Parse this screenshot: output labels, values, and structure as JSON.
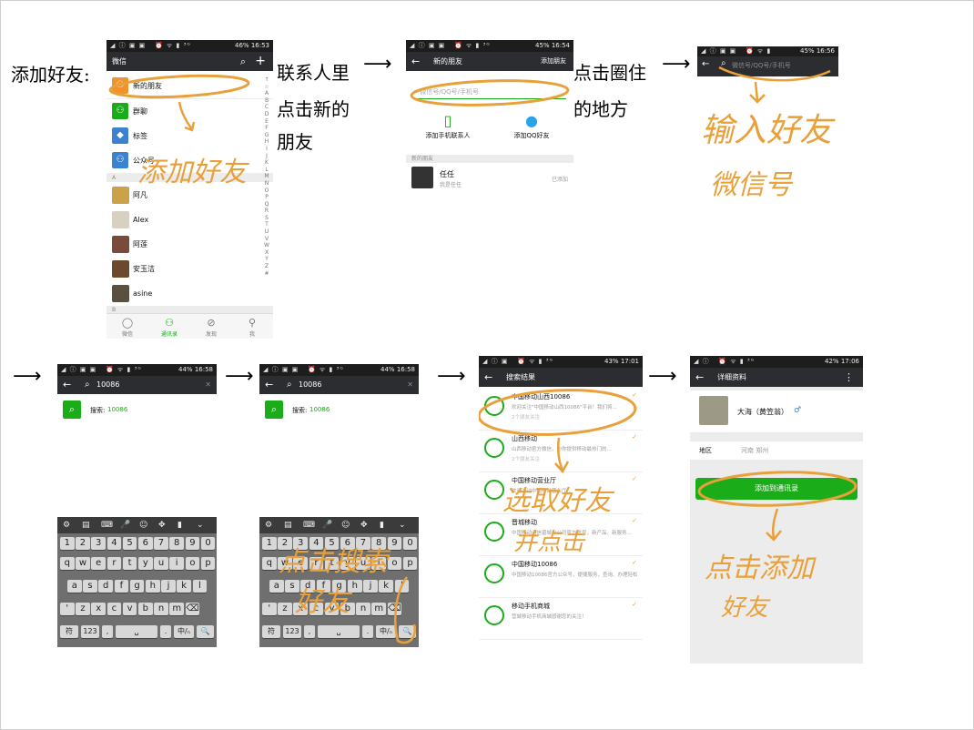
{
  "captions": {
    "intro": "添加好友:",
    "step1": [
      "联系人里",
      "点击新的",
      "朋友"
    ],
    "step2": [
      "点击圈住",
      "的地方"
    ]
  },
  "colors": {
    "accent_green": "#1aad19",
    "handwriting": "#e8a03a",
    "action_bar": "#2b2d31"
  },
  "screen1": {
    "status": {
      "battery": "46%",
      "time": "16:53"
    },
    "title": "微信",
    "search_icon": "search-icon",
    "add_icon": "plus-icon",
    "rows": [
      {
        "label": "新的朋友",
        "icon": "person-plus-icon",
        "color": "#f0932b"
      },
      {
        "label": "群聊",
        "icon": "group-icon",
        "color": "#1aad19"
      },
      {
        "label": "标签",
        "icon": "tag-icon",
        "color": "#3b82d0"
      },
      {
        "label": "公众号",
        "icon": "official-account-icon",
        "color": "#3b82d0"
      }
    ],
    "section_a": "A",
    "contacts": [
      "阿凡",
      "Alex",
      "阿莲",
      "安玉洁",
      "asine"
    ],
    "section_b": "B",
    "alphabet": [
      "↑",
      "☆",
      "A",
      "B",
      "C",
      "D",
      "E",
      "F",
      "G",
      "H",
      "I",
      "J",
      "K",
      "L",
      "M",
      "N",
      "O",
      "P",
      "Q",
      "R",
      "S",
      "T",
      "U",
      "V",
      "W",
      "X",
      "Y",
      "Z",
      "#"
    ],
    "tabs": [
      {
        "label": "微信",
        "icon": "chat-bubble-icon"
      },
      {
        "label": "通讯录",
        "icon": "contacts-icon"
      },
      {
        "label": "发现",
        "icon": "compass-icon"
      },
      {
        "label": "我",
        "icon": "profile-icon"
      }
    ],
    "handwriting": "添加好友"
  },
  "screen2": {
    "status": {
      "battery": "45%",
      "time": "16:54"
    },
    "title": "新的朋友",
    "action": "添加朋友",
    "search_placeholder": "微信号/QQ号/手机号",
    "options": [
      {
        "label": "添加手机联系人",
        "icon": "phone-icon"
      },
      {
        "label": "添加QQ好友",
        "icon": "qq-penguin-icon"
      }
    ],
    "section": "新的朋友",
    "friend": {
      "name": "任任",
      "sub": "我是任任",
      "status": "已添加"
    }
  },
  "screen3": {
    "status": {
      "battery": "45%",
      "time": "16:56"
    },
    "search_placeholder": "微信号/QQ号/手机号",
    "handwriting": [
      "输入好友",
      "微信号"
    ]
  },
  "screen4": {
    "status": {
      "battery": "44%",
      "time": "16:58"
    },
    "query": "10086",
    "result_prefix": "搜索: ",
    "result_query": "10086"
  },
  "screen5": {
    "status": {
      "battery": "44%",
      "time": "16:58"
    },
    "query": "10086",
    "result_prefix": "搜索: ",
    "result_query": "10086",
    "handwriting": [
      "点击搜索",
      "好友"
    ]
  },
  "keyboard": {
    "toolbar": [
      "⚙",
      "▤",
      "⌨",
      "🎤",
      "☺",
      "✥",
      "▮",
      "⌄"
    ],
    "row1": [
      "1",
      "2",
      "3",
      "4",
      "5",
      "6",
      "7",
      "8",
      "9",
      "0"
    ],
    "row2": [
      "q",
      "w",
      "e",
      "r",
      "t",
      "y",
      "u",
      "i",
      "o",
      "p"
    ],
    "row3": [
      "a",
      "s",
      "d",
      "f",
      "g",
      "h",
      "j",
      "k",
      "l"
    ],
    "row4": [
      "'",
      "z",
      "x",
      "c",
      "v",
      "b",
      "n",
      "m",
      "⌫"
    ],
    "row5": [
      "符",
      "123",
      ",",
      "␣",
      ".",
      "中/ₙ",
      "🔍"
    ]
  },
  "screen6": {
    "status": {
      "battery": "43%",
      "time": "17:01"
    },
    "title": "搜索结果",
    "results": [
      {
        "name": "中国移动山西10086",
        "desc": "欢迎关注\"中国移动山西10086\"平台！我们将...",
        "meta": "2个朋友关注"
      },
      {
        "name": "山西移动",
        "desc": "山西移动官方微信，为你提供移动最热门的...",
        "meta": "2个朋友关注"
      },
      {
        "name": "中国移动营业厅",
        "desc": "欢迎关注中国移动营业厅...",
        "meta": ""
      },
      {
        "name": "晋城移动",
        "desc": "中国移动通信晋城分公司官方账号，新产品、新服务...",
        "meta": ""
      },
      {
        "name": "中国移动10086",
        "desc": "中国移动10086官方公众号，便捷服务，查询、办理轻松搞定，在这里您可以看新华...",
        "meta": ""
      },
      {
        "name": "移动手机商城",
        "desc": "营城移动手机商城感谢您的关注！",
        "meta": ""
      }
    ],
    "handwriting": [
      "选取好友",
      "并点击"
    ]
  },
  "screen7": {
    "status": {
      "battery": "42%",
      "time": "17:06"
    },
    "title": "详细资料",
    "name": "大海（黄笠翁）",
    "region_label": "地区",
    "region_value": "河南  郑州",
    "add_button": "添加到通讯录",
    "handwriting": [
      "点击添加",
      "好友"
    ]
  }
}
